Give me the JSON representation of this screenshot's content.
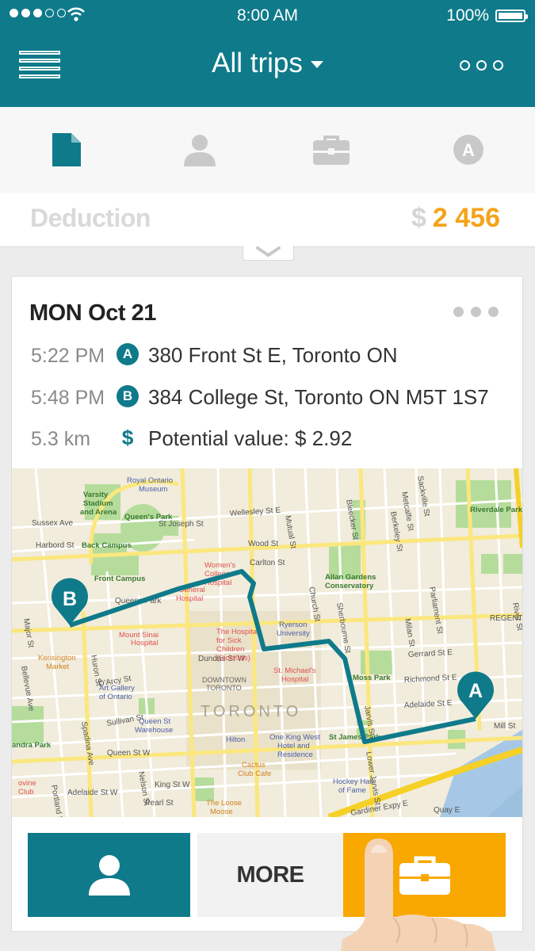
{
  "status_bar": {
    "time": "8:00 AM",
    "battery": "100%"
  },
  "header": {
    "title": "All trips"
  },
  "tabs": [
    {
      "icon": "document-icon",
      "active": true
    },
    {
      "icon": "person-icon",
      "active": false
    },
    {
      "icon": "briefcase-icon",
      "active": false
    },
    {
      "icon": "auto-a-icon",
      "active": false,
      "text": "A"
    }
  ],
  "summary": {
    "label": "Deduction",
    "currency": "$",
    "amount": "2 456"
  },
  "trip": {
    "day": "MON",
    "date": "Oct 21",
    "start": {
      "time": "5:22 PM",
      "badge": "A",
      "address": "380 Front St E, Toronto ON"
    },
    "end": {
      "time": "5:48 PM",
      "badge": "B",
      "address": "384 College St, Toronto ON M5T 1S7"
    },
    "distance": "5.3 km",
    "value_label": "Potential value: $ 2.92",
    "map": {
      "city": "TORONTO",
      "downtown": "DOWNTOWN\nTORONTO",
      "pin_a": "A",
      "pin_b": "B",
      "streets": [
        "Harbord St",
        "Wellesley St E",
        "Carlton St",
        "Dundas St W",
        "Richmond St E",
        "Adelaide St E",
        "Queen St W",
        "King St W",
        "Gardiner Expy E",
        "Spadina Ave",
        "Sussex Ave",
        "St Joseph St",
        "Wood St",
        "Gerrard St E",
        "Mill St",
        "Queens Park",
        "Mutual St",
        "Jarvis St",
        "Lower Jarvis St",
        "Parliament St",
        "Berkeley St",
        "Sherbourne St",
        "Church St",
        "Bleecker St",
        "Sackville St",
        "River St",
        "Regent Park",
        "Adelaide St W",
        "Pearl St",
        "Nelson St",
        "Sullivan St",
        "D'Arcy St",
        "Huron St",
        "Major St",
        "Bellevue Ave",
        "Portland St",
        "Quay E",
        "Milan St",
        "Metcalfe St"
      ],
      "places": [
        "Royal Ontario Museum",
        "Varsity Stadium and Arena",
        "Queen's Park",
        "Back Campus",
        "Front Campus",
        "Women's College Hospital",
        "Toronto General Hospital",
        "Mount Sinai Hospital",
        "The Hospital for Sick Children (SickKids)",
        "Ryerson University",
        "Allan Gardens Conservatory",
        "Riverdale Park",
        "Kensington Market",
        "Art Gallery of Ontario",
        "St. Michael's Hospital",
        "Moss Park",
        "Queen St Warehouse",
        "Hilton",
        "One King West Hotel and Residence",
        "St James Park",
        "Cactus Club Cafe",
        "Hockey Hall of Fame",
        "The Loose Moose",
        "Alexandra Park",
        "Bovine Club"
      ]
    }
  },
  "actions": {
    "more_label": "MORE"
  },
  "colors": {
    "primary": "#0f7a8a",
    "accent": "#f9a800",
    "amount": "#f5a31a"
  }
}
